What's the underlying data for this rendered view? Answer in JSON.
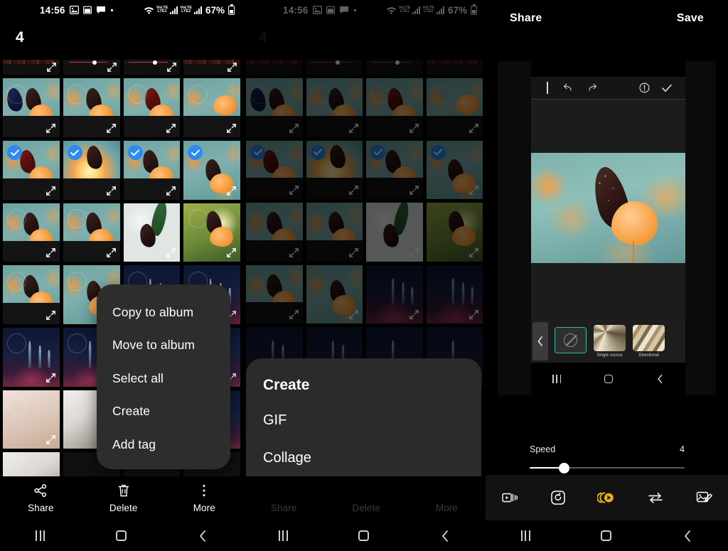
{
  "status_bar": {
    "time": "14:56",
    "icons": [
      "photo-icon",
      "calendar-icon",
      "message-icon",
      "dot-icon"
    ],
    "wifi": "wifi-icon",
    "sim1_label_top": "VoLTE",
    "sim1_label_bottom": "LTE1",
    "sim2_label_top": "VoLTE",
    "sim2_label_bottom": "LTE2",
    "battery_percent": "67%"
  },
  "panel1": {
    "selection_count": "4",
    "context_menu": {
      "items": [
        {
          "label": "Copy to album"
        },
        {
          "label": "Move to album"
        },
        {
          "label": "Select all"
        },
        {
          "label": "Create"
        },
        {
          "label": "Add tag"
        }
      ]
    },
    "action_bar": [
      {
        "label": "Share",
        "icon": "share-icon"
      },
      {
        "label": "Delete",
        "icon": "trash-icon"
      },
      {
        "label": "More",
        "icon": "more-vertical-icon"
      }
    ],
    "nav_bar": [
      {
        "icon": "recents-icon"
      },
      {
        "icon": "home-icon"
      },
      {
        "icon": "back-icon"
      }
    ]
  },
  "panel2": {
    "selection_count": "4",
    "submenu": {
      "title": "Create",
      "items": [
        {
          "label": "GIF"
        },
        {
          "label": "Collage"
        }
      ]
    },
    "action_bar": [
      {
        "label": "Share"
      },
      {
        "label": "Delete"
      },
      {
        "label": "More"
      }
    ]
  },
  "panel3": {
    "top_bar": {
      "share_label": "Share",
      "save_label": "Save"
    },
    "preview_toolbar": [
      {
        "icon": "text-cursor-icon"
      },
      {
        "icon": "undo-icon"
      },
      {
        "icon": "redo-icon"
      },
      {
        "icon": "info-icon"
      },
      {
        "icon": "check-icon"
      }
    ],
    "play_button": {
      "icon": "play-icon",
      "color": "#2fb6a8"
    },
    "filters": {
      "prev_icon": "chevron-left-icon",
      "items": [
        {
          "label": "",
          "icon": "no-filter-icon",
          "selected": true
        },
        {
          "label": "Single source",
          "selected": false
        },
        {
          "label": "Directional",
          "selected": false
        }
      ]
    },
    "speed": {
      "label": "Speed",
      "value": "4",
      "percent": 22
    },
    "edit_tools": [
      {
        "icon": "video-clip-icon",
        "active": false
      },
      {
        "icon": "loop-icon",
        "active": false
      },
      {
        "icon": "speed-icon",
        "active": true
      },
      {
        "icon": "direction-swap-icon",
        "active": false
      },
      {
        "icon": "decorate-icon",
        "active": false
      }
    ]
  },
  "accent_colors": {
    "checkbox_blue": "#2b8bf2",
    "teal": "#2fb6a8",
    "amber": "#e5b117"
  }
}
